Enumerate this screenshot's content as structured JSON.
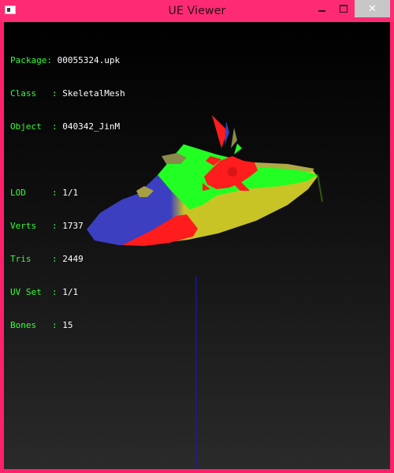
{
  "window": {
    "title": "UE Viewer",
    "close_glyph": "✕"
  },
  "info": {
    "package": {
      "label": "Package: ",
      "value": "00055324.upk"
    },
    "class": {
      "label": "Class   : ",
      "value": "SkeletalMesh"
    },
    "object": {
      "label": "Object  : ",
      "value": "040342_JinM"
    },
    "lod": {
      "label": "LOD     : ",
      "value": "1/1"
    },
    "verts": {
      "label": "Verts   : ",
      "value": "1737"
    },
    "tris": {
      "label": "Tris    : ",
      "value": "2449"
    },
    "uvset": {
      "label": "UV Set  : ",
      "value": "1/1"
    },
    "bones": {
      "label": "Bones   : ",
      "value": "15"
    }
  },
  "colors": {
    "label_green": "#33ff33",
    "value_white": "#ffffff",
    "mesh_blue": "#3c3fc0",
    "mesh_green": "#22ff22",
    "mesh_yellow": "#c9c426",
    "mesh_red": "#ff1c1c",
    "axis_blue": "#1a1aa8"
  }
}
